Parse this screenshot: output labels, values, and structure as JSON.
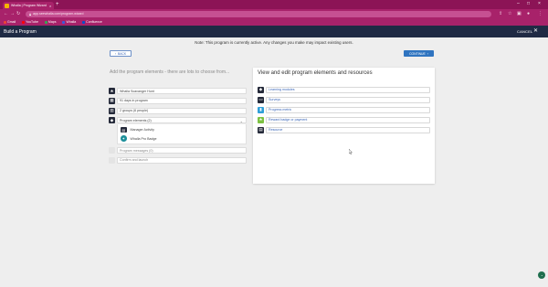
{
  "browser": {
    "tab_title": "Whalla | Program Wizard",
    "tab_close": "×",
    "new_tab": "+",
    "url": "app.seewhalla.com/program-wizard",
    "win_min": "–",
    "win_max": "□",
    "win_close": "×",
    "bookmarks": [
      {
        "label": "Gmail",
        "color": "#ea4335"
      },
      {
        "label": "YouTube",
        "color": "#ff0000"
      },
      {
        "label": "Maps",
        "color": "#34a853"
      },
      {
        "label": "Whalla",
        "color": "#3b5bdb"
      },
      {
        "label": "Confluence",
        "color": "#0052cc"
      }
    ]
  },
  "header": {
    "title": "Build a Program",
    "cancel_label": "CANCEL",
    "close_glyph": "✕"
  },
  "note": "Note: This program is currently active. Any changes you make may impact existing users.",
  "buttons": {
    "back_label": "BACK",
    "back_glyph": "‹",
    "continue_label": "CONTINUE",
    "continue_glyph": "›"
  },
  "left": {
    "heading": "Add the program elements - there are lots to choose from...",
    "elements": [
      {
        "label": "Whalla Scavanger Hunt",
        "icon": "star-icon",
        "glyph": "★"
      },
      {
        "label": "91 days in program",
        "icon": "calendar-icon",
        "glyph": "▦"
      },
      {
        "label": "2 groups (6 people)",
        "icon": "people-icon",
        "glyph": "▥"
      },
      {
        "label": "Program elements (2)",
        "icon": "mortarboard-icon",
        "glyph": "◆",
        "expand_glyph": "⌄"
      }
    ],
    "sub_items": [
      {
        "label": "Manager Activity",
        "icon": "clipboard-icon",
        "glyph": "▤"
      },
      {
        "label": "Whalla Pro Badge",
        "icon": "badge-icon",
        "glyph": "✦"
      }
    ],
    "disabled_elements": [
      {
        "label": "Program messages (0)"
      },
      {
        "label": "Confirm and launch"
      }
    ]
  },
  "right": {
    "title": "View and edit program elements and resources",
    "resources": [
      {
        "label": "Learning modules",
        "icon": "mortarboard-icon",
        "glyph": "◆",
        "color": "#252a3a"
      },
      {
        "label": "Surveys",
        "icon": "survey-icon",
        "glyph": "▭",
        "color": "#252a3a"
      },
      {
        "label": "Progress metric",
        "icon": "chart-icon",
        "glyph": "▮",
        "color": "#2f9fd8"
      },
      {
        "label": "Reward badge or payment",
        "icon": "reward-icon",
        "glyph": "★",
        "color": "#7cc142"
      },
      {
        "label": "Resource",
        "icon": "document-icon",
        "glyph": "▤",
        "color": "#252a3a"
      }
    ]
  }
}
